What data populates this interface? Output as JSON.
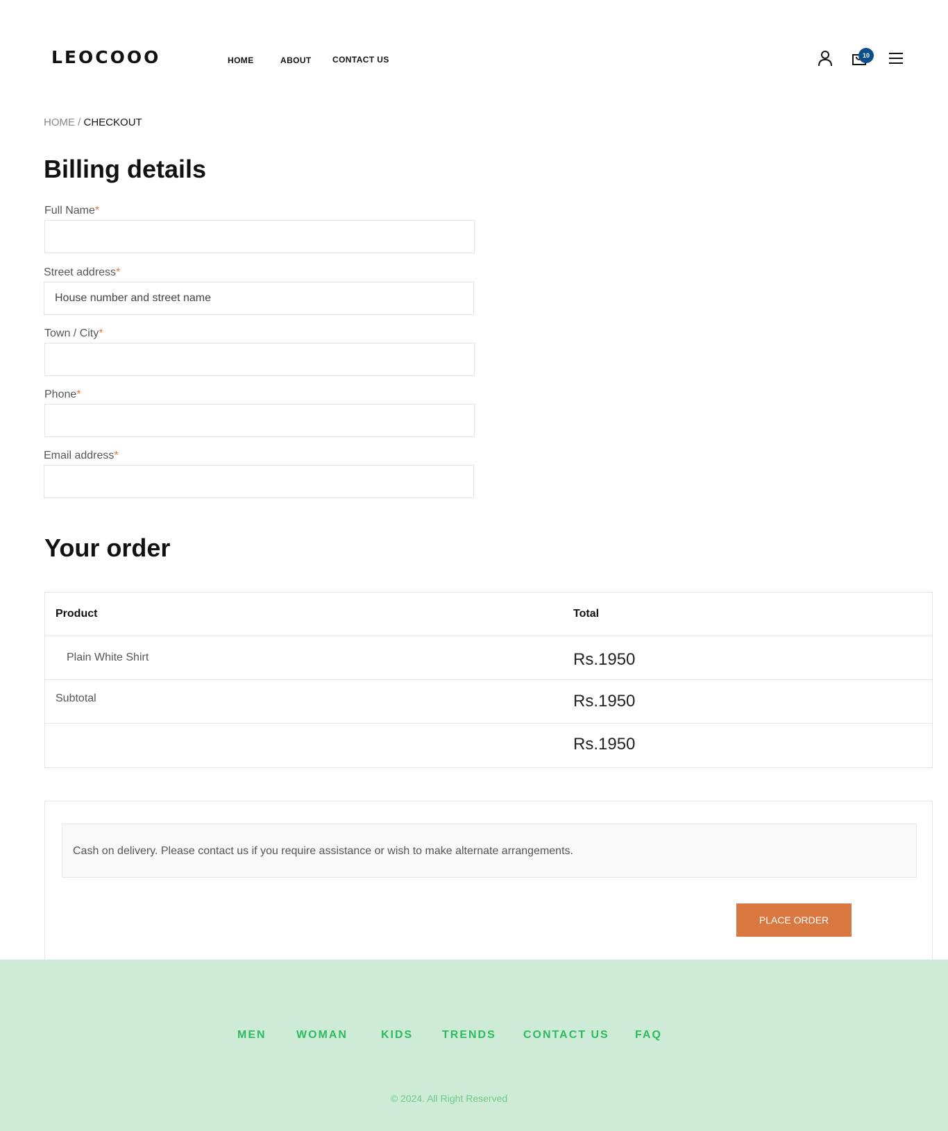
{
  "header": {
    "logo": "LEOCOOO",
    "nav": [
      "HOME",
      "ABOUT",
      "CONTACT US"
    ],
    "cart_count": "10",
    "icons": [
      "user-icon",
      "cart-icon",
      "menu-icon"
    ]
  },
  "breadcrumb": {
    "home": "HOME",
    "separator": " / ",
    "current": "CHECKOUT"
  },
  "billing": {
    "title": "Billing details",
    "fields": [
      {
        "label": "Full Name",
        "placeholder": ""
      },
      {
        "label": "Street address",
        "placeholder": "House number and street name"
      },
      {
        "label": "Town / City",
        "placeholder": ""
      },
      {
        "label": "Phone",
        "placeholder": ""
      },
      {
        "label": "Email address",
        "placeholder": ""
      }
    ],
    "required_mark": "*"
  },
  "order": {
    "title": "Your order",
    "columns": [
      "Product",
      "Total"
    ],
    "item": {
      "name": "Plain White Shirt",
      "total": "Rs.1950"
    },
    "subtotal": {
      "label": "Subtotal",
      "value": "Rs.1950"
    },
    "total": {
      "label": "",
      "value": "Rs.1950"
    }
  },
  "payment": {
    "note": "Cash on delivery.  Please contact us if you require assistance or wish to make alternate arrangements.",
    "button": "PLACE ORDER"
  },
  "footer": {
    "nav": [
      "MEN",
      "WOMAN",
      "KIDS",
      "TRENDS",
      "CONTACT US",
      "FAQ"
    ],
    "copyright": "© 2024. All Right Reserved"
  },
  "colors": {
    "accent": "#d97840",
    "badge": "#0b4f8a",
    "footer_bg": "#cdebd6",
    "footer_link": "#2dbb5f"
  }
}
